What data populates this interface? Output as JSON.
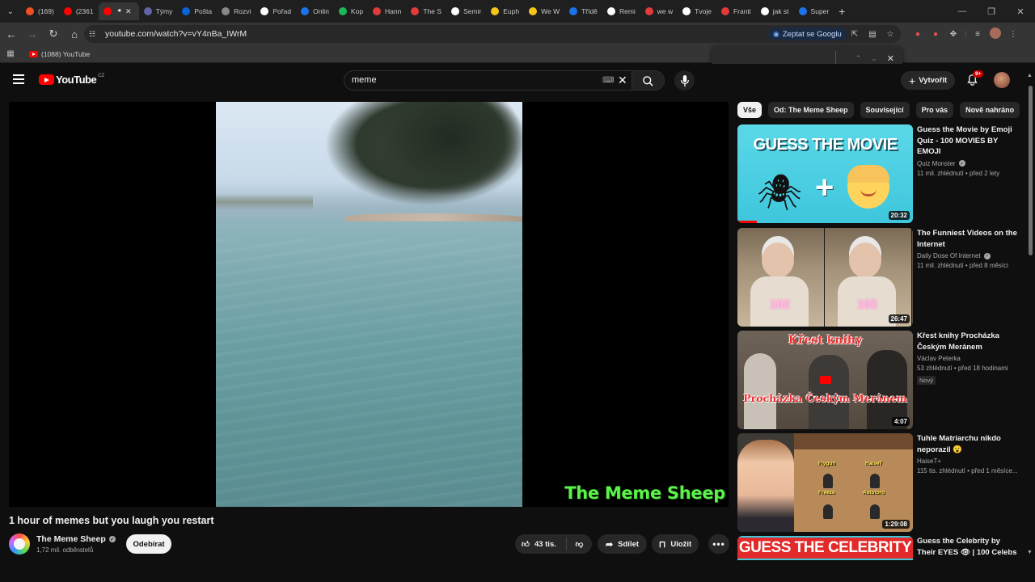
{
  "browser": {
    "tabs": [
      {
        "label": "(169)",
        "color": "#f25022",
        "active": false
      },
      {
        "label": "(2361",
        "color": "#ff0000",
        "active": false
      },
      {
        "label": "",
        "color": "#ff0000",
        "active": true
      },
      {
        "label": "Týmy",
        "color": "#6264a7",
        "active": false
      },
      {
        "label": "Pošta",
        "color": "#0a64d8",
        "active": false
      },
      {
        "label": "Rozvi",
        "color": "#888888",
        "active": false
      },
      {
        "label": "Pořad",
        "color": "#ffffff",
        "active": false
      },
      {
        "label": "Onlin",
        "color": "#1a73e8",
        "active": false
      },
      {
        "label": "Kop",
        "color": "#1db954",
        "active": false
      },
      {
        "label": "Hann",
        "color": "#e33b3b",
        "active": false
      },
      {
        "label": "The S",
        "color": "#e33b3b",
        "active": false
      },
      {
        "label": "Semir",
        "color": "#ffffff",
        "active": false
      },
      {
        "label": "Euph",
        "color": "#f5c518",
        "active": false
      },
      {
        "label": "We W",
        "color": "#f5c518",
        "active": false
      },
      {
        "label": "Třídě",
        "color": "#1a73e8",
        "active": false
      },
      {
        "label": "Remi",
        "color": "#ffffff",
        "active": false
      },
      {
        "label": "we w",
        "color": "#e33b3b",
        "active": false
      },
      {
        "label": "Tvoje",
        "color": "#ffffff",
        "active": false
      },
      {
        "label": "Franti",
        "color": "#e33b3b",
        "active": false
      },
      {
        "label": "jak st",
        "color": "#ffffff",
        "active": false
      },
      {
        "label": "Super",
        "color": "#1a73e8",
        "active": false
      }
    ],
    "url": "youtube.com/watch?v=vY4nBa_IWrM",
    "ask_google": "Zeptat se Googlu",
    "bookmark": "(1088) YouTube"
  },
  "youtube": {
    "logo": "YouTube",
    "country": "CZ",
    "search_query": "meme",
    "create_label": "Vytvořit",
    "notifications": "9+"
  },
  "video": {
    "watermark": "The Meme Sheep",
    "title": "1 hour of memes but you laugh you restart",
    "channel": "The Meme Sheep",
    "subscribers": "1,72 mil. odběratelů",
    "subscribe_label": "Odebírat",
    "likes": "43 tis.",
    "share_label": "Sdílet",
    "save_label": "Uložit"
  },
  "sidebar": {
    "chips": [
      "Vše",
      "Od: The Meme Sheep",
      "Související",
      "Pro vás",
      "Nově nahráno"
    ],
    "recommendations": [
      {
        "title": "Guess the Movie by Emoji Quiz - 100 MOVIES BY EMOJI",
        "channel": "Quiz Monster",
        "verified": true,
        "meta": "11 mil. zhlédnutí • před 2 lety",
        "duration": "20:32",
        "thumb_text": "GUESS THE MOVIE",
        "badge": ""
      },
      {
        "title": "The Funniest Videos on the Internet",
        "channel": "Daily Dose Of Internet",
        "verified": true,
        "meta": "11 mil. zhlédnutí • před 8 měsíci",
        "duration": "26:47",
        "thumb_text": "102",
        "badge": ""
      },
      {
        "title": "Křest knihy Procházka Českým Meránem",
        "channel": "Václav Peterka",
        "verified": false,
        "meta": "53 zhlédnutí • před 18 hodinami",
        "duration": "4:07",
        "thumb_text": "Křest knihy",
        "thumb_text2": "Procházka Českým Meránem",
        "badge": "Nový"
      },
      {
        "title": "Tuhle Matriarchu nikdo neporazil 😮",
        "channel": "HaiseT+",
        "verified": false,
        "meta": "115 tis. zhlédnutí • před 1 měsíce...",
        "duration": "1:29:08",
        "thumb_labels": [
          "Flygun",
          "HaiseT",
          "Freeze",
          "Astotoro"
        ],
        "badge": ""
      },
      {
        "title": "Guess the Celebrity by Their EYES 👁 | 100 Celebs ...",
        "channel": "",
        "verified": false,
        "meta": "",
        "duration": "",
        "thumb_text": "GUESS THE CELEBRITY",
        "badge": ""
      }
    ]
  }
}
